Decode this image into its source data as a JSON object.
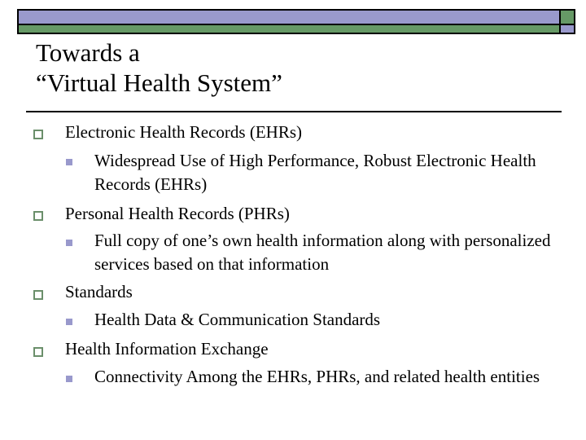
{
  "colors": {
    "header_purple": "#9999cc",
    "header_green": "#669966",
    "bullet_level1": "#6b8f6b",
    "bullet_level2": "#9999cc",
    "text": "#000000"
  },
  "slide": {
    "title_lines": [
      "Towards a",
      "“Virtual Health System”"
    ],
    "bullets": [
      {
        "icon": "hollow-square-bullet",
        "text": "Electronic Health Records (EHRs)",
        "sub": [
          {
            "icon": "filled-square-bullet",
            "text": "Widespread Use of High Performance, Robust Electronic Health Records (EHRs)"
          }
        ]
      },
      {
        "icon": "hollow-square-bullet",
        "text": "Personal Health Records (PHRs)",
        "sub": [
          {
            "icon": "filled-square-bullet",
            "text": "Full copy of one’s own health information along with personalized services based on that information"
          }
        ]
      },
      {
        "icon": "hollow-square-bullet",
        "text": "Standards",
        "sub": [
          {
            "icon": "filled-square-bullet",
            "text": "Health Data & Communication Standards"
          }
        ]
      },
      {
        "icon": "hollow-square-bullet",
        "text": "Health Information Exchange",
        "sub": [
          {
            "icon": "filled-square-bullet",
            "text": "Connectivity Among the EHRs, PHRs, and related health entities"
          }
        ]
      }
    ]
  }
}
